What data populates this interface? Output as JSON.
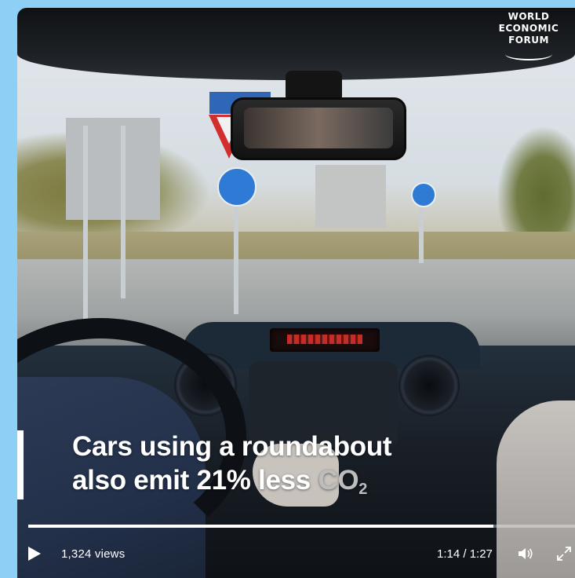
{
  "video": {
    "brand_logo": {
      "lines": [
        "WORLD",
        "ECONOMIC",
        "FORUM"
      ]
    },
    "caption": {
      "line1": "Cars using a roundabout",
      "line2_prefix": "also emit 21% less",
      "line2_co2": "CO",
      "line2_sub": "2"
    },
    "controls": {
      "play_icon": "play-icon",
      "views": "1,324 views",
      "time": "1:14 / 1:27",
      "volume_icon": "volume-icon",
      "fullscreen_icon": "fullscreen-icon"
    },
    "progress_fraction": 0.851
  },
  "colors": {
    "page_background": "#8ecff6",
    "progress_fill": "#ffffff",
    "caption_text": "#ffffff"
  }
}
